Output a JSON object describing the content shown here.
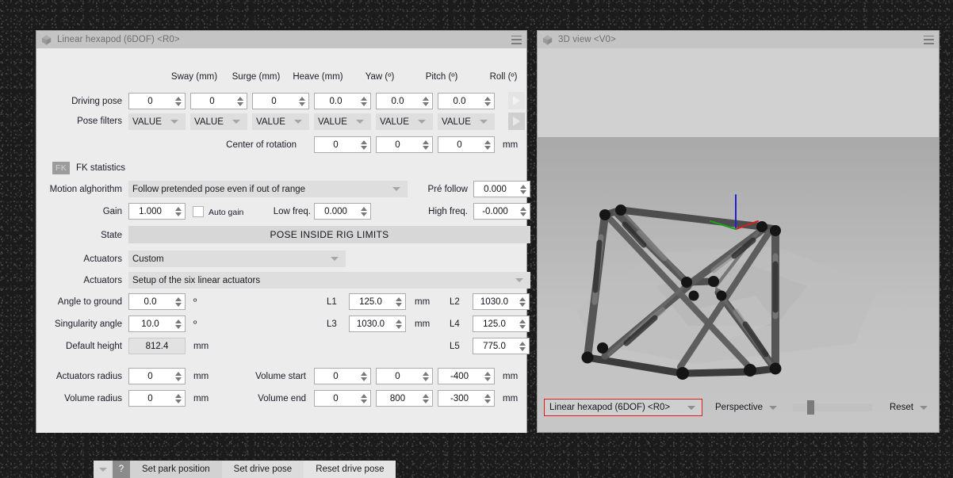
{
  "left_panel": {
    "title": "Linear hexapod (6DOF) <R0>",
    "icon": "hexapod-icon",
    "menu_icon": "hamburger-icon",
    "column_headers": [
      "Sway (mm)",
      "Surge (mm)",
      "Heave (mm)",
      "Yaw (º)",
      "Pitch (º)",
      "Roll (º)"
    ],
    "rows": {
      "driving_pose": {
        "label": "Driving pose",
        "values": [
          "0",
          "0",
          "0",
          "0.0",
          "0.0",
          "0.0"
        ]
      },
      "pose_filters": {
        "label": "Pose filters",
        "values": [
          "VALUE",
          "VALUE",
          "VALUE",
          "VALUE",
          "VALUE",
          "VALUE"
        ]
      },
      "center_of_rotation": {
        "label": "Center of rotation",
        "values": [
          "0",
          "0",
          "0"
        ],
        "unit": "mm"
      }
    },
    "fk": {
      "badge": "FK",
      "label": "FK statistics"
    },
    "motion": {
      "label": "Motion alghorithm",
      "value": "Follow pretended pose even if out of range",
      "pre_follow_label": "Pré follow",
      "pre_follow_value": "0.000"
    },
    "gain": {
      "label": "Gain",
      "value": "1.000",
      "auto_gain_label": "Auto gain",
      "auto_gain_checked": false,
      "low_freq_label": "Low freq.",
      "low_freq_value": "0.000",
      "high_freq_label": "High freq.",
      "high_freq_value": "-0.000"
    },
    "state": {
      "label": "State",
      "value": "POSE INSIDE RIG LIMITS"
    },
    "actuators_type": {
      "label": "Actuators",
      "value": "Custom"
    },
    "actuators_setup": {
      "label": "Actuators",
      "value": "Setup of the six linear actuators"
    },
    "angle_to_ground": {
      "label": "Angle to ground",
      "value": "0.0",
      "unit": "º"
    },
    "singularity_angle": {
      "label": "Singularity angle",
      "value": "10.0",
      "unit": "º"
    },
    "default_height": {
      "label": "Default height",
      "value": "812.4",
      "unit": "mm"
    },
    "lengths": [
      {
        "label": "L1",
        "value": "125.0",
        "unit": "mm"
      },
      {
        "label": "L2",
        "value": "1030.0",
        "unit": "mm"
      },
      {
        "label": "L3",
        "value": "1030.0",
        "unit": "mm"
      },
      {
        "label": "L4",
        "value": "125.0",
        "unit": "mm"
      },
      {
        "label": "L5",
        "value": "775.0",
        "unit": "mm"
      }
    ],
    "actuators_radius": {
      "label": "Actuators radius",
      "value": "0",
      "unit": "mm"
    },
    "volume_radius": {
      "label": "Volume radius",
      "value": "0",
      "unit": "mm"
    },
    "volume_start": {
      "label": "Volume start",
      "values": [
        "0",
        "0",
        "-400"
      ],
      "unit": "mm"
    },
    "volume_end": {
      "label": "Volume end",
      "values": [
        "0",
        "800",
        "-300"
      ],
      "unit": "mm"
    },
    "buttons": {
      "caret": "caret-down-icon",
      "help": "?",
      "set_park_position": "Set park position",
      "set_drive_pose": "Set drive pose",
      "reset_drive_pose": "Reset drive pose"
    },
    "play_buttons": [
      "play-arrow-driving-pose",
      "play-arrow-pose-filters"
    ]
  },
  "right_panel": {
    "title": "3D view <V0>",
    "icon": "hexapod-icon",
    "menu_icon": "hamburger-icon",
    "toolbar": {
      "rig_selector": "Linear hexapod (6DOF) <R0>",
      "projection": "Perspective",
      "zoom_slider_value": 20,
      "reset": "Reset"
    },
    "scene": {
      "description": "linear hexapod 6DOF rig wireframe with six actuator struts",
      "gizmo_axes": [
        "x-axis-red",
        "y-axis-green",
        "z-axis-blue"
      ]
    }
  },
  "colors": {
    "window_bg": "#ececec",
    "titlebar": "#c4c4c4",
    "accent_highlight": "#e21b1b",
    "strut": "#4a4a4a",
    "joint": "#1e1e1e",
    "axis_x": "#d22020",
    "axis_y": "#1e9e1e",
    "axis_z": "#2020d2"
  }
}
